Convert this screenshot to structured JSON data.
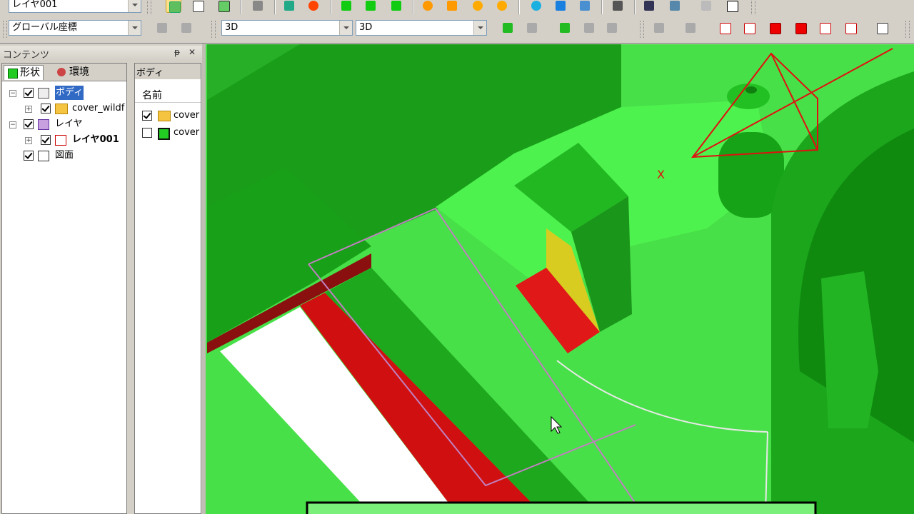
{
  "toolbar_top": {
    "layer_combo_value": "レイヤ001"
  },
  "toolbar_second": {
    "coord_combo_value": "グローバル座標",
    "view_combo1_value": "3D",
    "view_combo2_value": "3D"
  },
  "contents_panel": {
    "title": "コンテンツ",
    "pin_label": "ᵽ",
    "close_label": "✕",
    "tabs": [
      {
        "label": "形状",
        "active": true
      },
      {
        "label": "環境",
        "active": false
      }
    ],
    "tree": [
      {
        "label": "ボディ",
        "checked": true
      },
      {
        "label": "cover_wildf",
        "checked": true
      },
      {
        "label": "レイヤ",
        "checked": true
      },
      {
        "label": "レイヤ001",
        "checked": true
      },
      {
        "label": "図面",
        "checked": true
      }
    ]
  },
  "body_list": {
    "header": "ボディ",
    "column_name": "名前",
    "items": [
      {
        "label": "cover",
        "checked": true
      },
      {
        "label": "cover",
        "checked": false
      }
    ]
  },
  "viewport": {
    "marker_label": "X"
  },
  "colors": {
    "model_green": "#3fd43f",
    "dark_green": "#1a8a1a",
    "red": "#d01010",
    "yellow": "#d8cc20"
  }
}
